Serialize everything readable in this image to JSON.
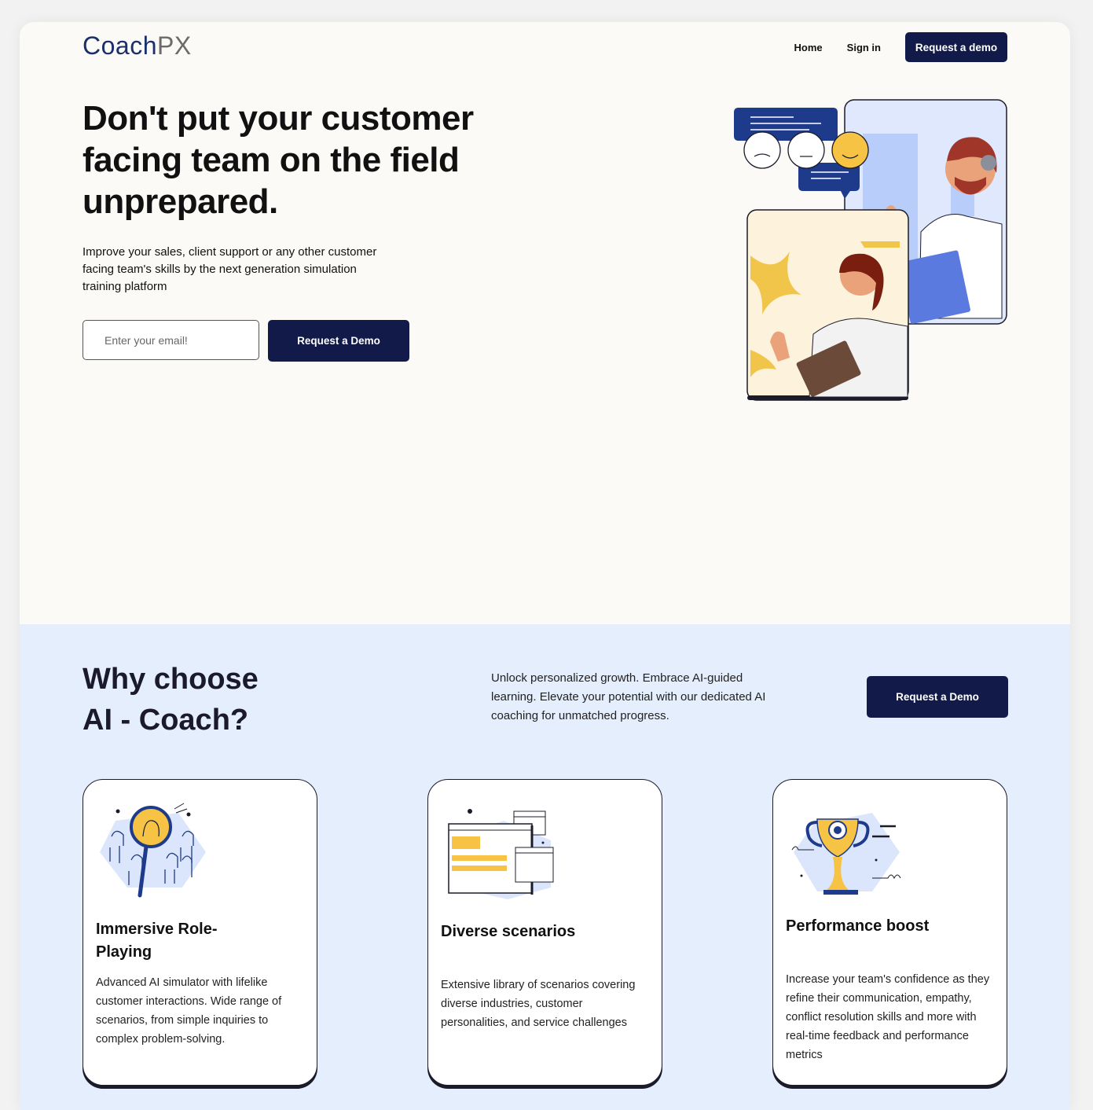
{
  "nav": {
    "logo_part1": "Coach",
    "logo_part2": "PX",
    "home": "Home",
    "signin": "Sign in",
    "demo": "Request a demo"
  },
  "hero": {
    "title": "Don't put your customer facing team on the field unprepared.",
    "subtitle": "Improve your sales, client support or any other customer facing team's skills by the next generation simulation training platform",
    "email_placeholder": "Enter your email!",
    "cta": "Request a Demo"
  },
  "why": {
    "title_line1": "Why choose",
    "title_line2": "AI - Coach?",
    "description": "Unlock personalized growth. Embrace AI-guided learning. Elevate your potential with our dedicated AI coaching for unmatched progress.",
    "cta": "Request a Demo"
  },
  "cards": [
    {
      "title": "Immersive Role-Playing",
      "text": "Advanced AI simulator with lifelike customer interactions. Wide range of scenarios, from simple inquiries to complex problem-solving.",
      "icon": "magnifier-people-icon"
    },
    {
      "title": "Diverse scenarios",
      "text": "Extensive library of scenarios covering diverse industries, customer personalities, and service challenges",
      "icon": "browser-windows-icon"
    },
    {
      "title": "Performance boost",
      "text": "Increase your team's confidence as they refine their communication, empathy, conflict resolution skills and more with real-time feedback and performance metrics",
      "icon": "trophy-icon"
    }
  ],
  "colors": {
    "primary_button": "#121a4a",
    "hero_bg": "#fbfaf6",
    "section_bg": "#e5eefd",
    "accent_yellow": "#f6c344",
    "accent_blue": "#1e3a8a"
  }
}
